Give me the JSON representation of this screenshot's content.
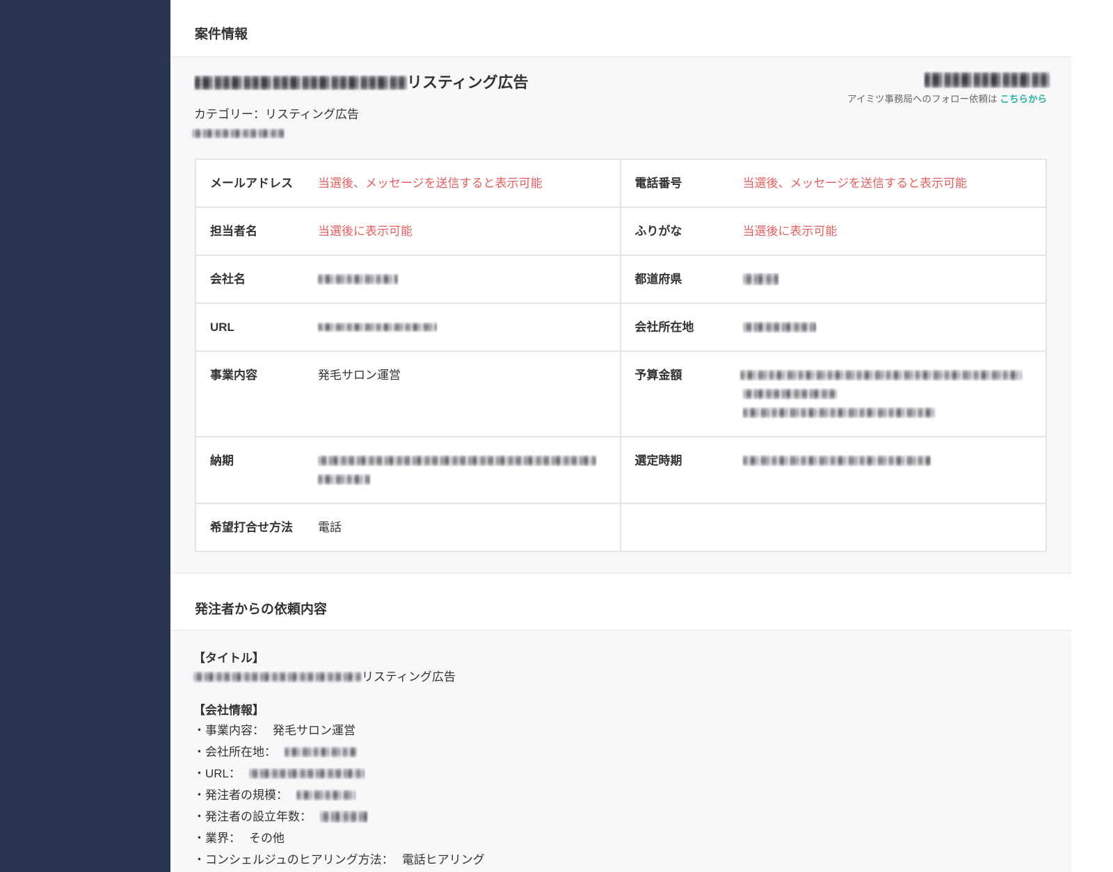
{
  "colors": {
    "sidebar": "#2b3551",
    "notice": "#e35f5f",
    "link": "#2ab1a1"
  },
  "project": {
    "heading": "案件情報",
    "title": "リスティング広告",
    "follow_text": "アイミツ事務局へのフォロー依頼は",
    "follow_link": "こちらから",
    "category_label": "カテゴリー：",
    "category_value": "リスティング広告",
    "details": [
      {
        "left": {
          "label": "メールアドレス",
          "value": "当選後、メッセージを送信すると表示可能"
        },
        "right": {
          "label": "電話番号",
          "value": "当選後、メッセージを送信すると表示可能"
        }
      },
      {
        "left": {
          "label": "担当者名",
          "value": "当選後に表示可能"
        },
        "right": {
          "label": "ふりがな",
          "value": "当選後に表示可能"
        }
      },
      {
        "left": {
          "label": "会社名"
        },
        "right": {
          "label": "都道府県"
        }
      },
      {
        "left": {
          "label": "URL"
        },
        "right": {
          "label": "会社所在地"
        }
      },
      {
        "left": {
          "label": "事業内容",
          "value": "発毛サロン運営"
        },
        "right": {
          "label": "予算金額"
        }
      },
      {
        "left": {
          "label": "納期"
        },
        "right": {
          "label": "選定時期"
        }
      },
      {
        "left": {
          "label": "希望打合せ方法",
          "value": "電話"
        },
        "right": {}
      }
    ]
  },
  "request": {
    "heading": "発注者からの依頼内容",
    "title_heading": "【タイトル】",
    "title": "リスティング広告",
    "company_heading": "【会社情報】",
    "company_items": [
      {
        "label": "・事業内容：",
        "value": "発毛サロン運営"
      },
      {
        "label": "・会社所在地："
      },
      {
        "label": "・URL："
      },
      {
        "label": "・発注者の規模："
      },
      {
        "label": "・発注者の設立年数："
      },
      {
        "label": "・業界：",
        "value": "その他"
      },
      {
        "label": "・コンシェルジュのヒアリング方法：",
        "value": "電話ヒアリング"
      }
    ]
  }
}
